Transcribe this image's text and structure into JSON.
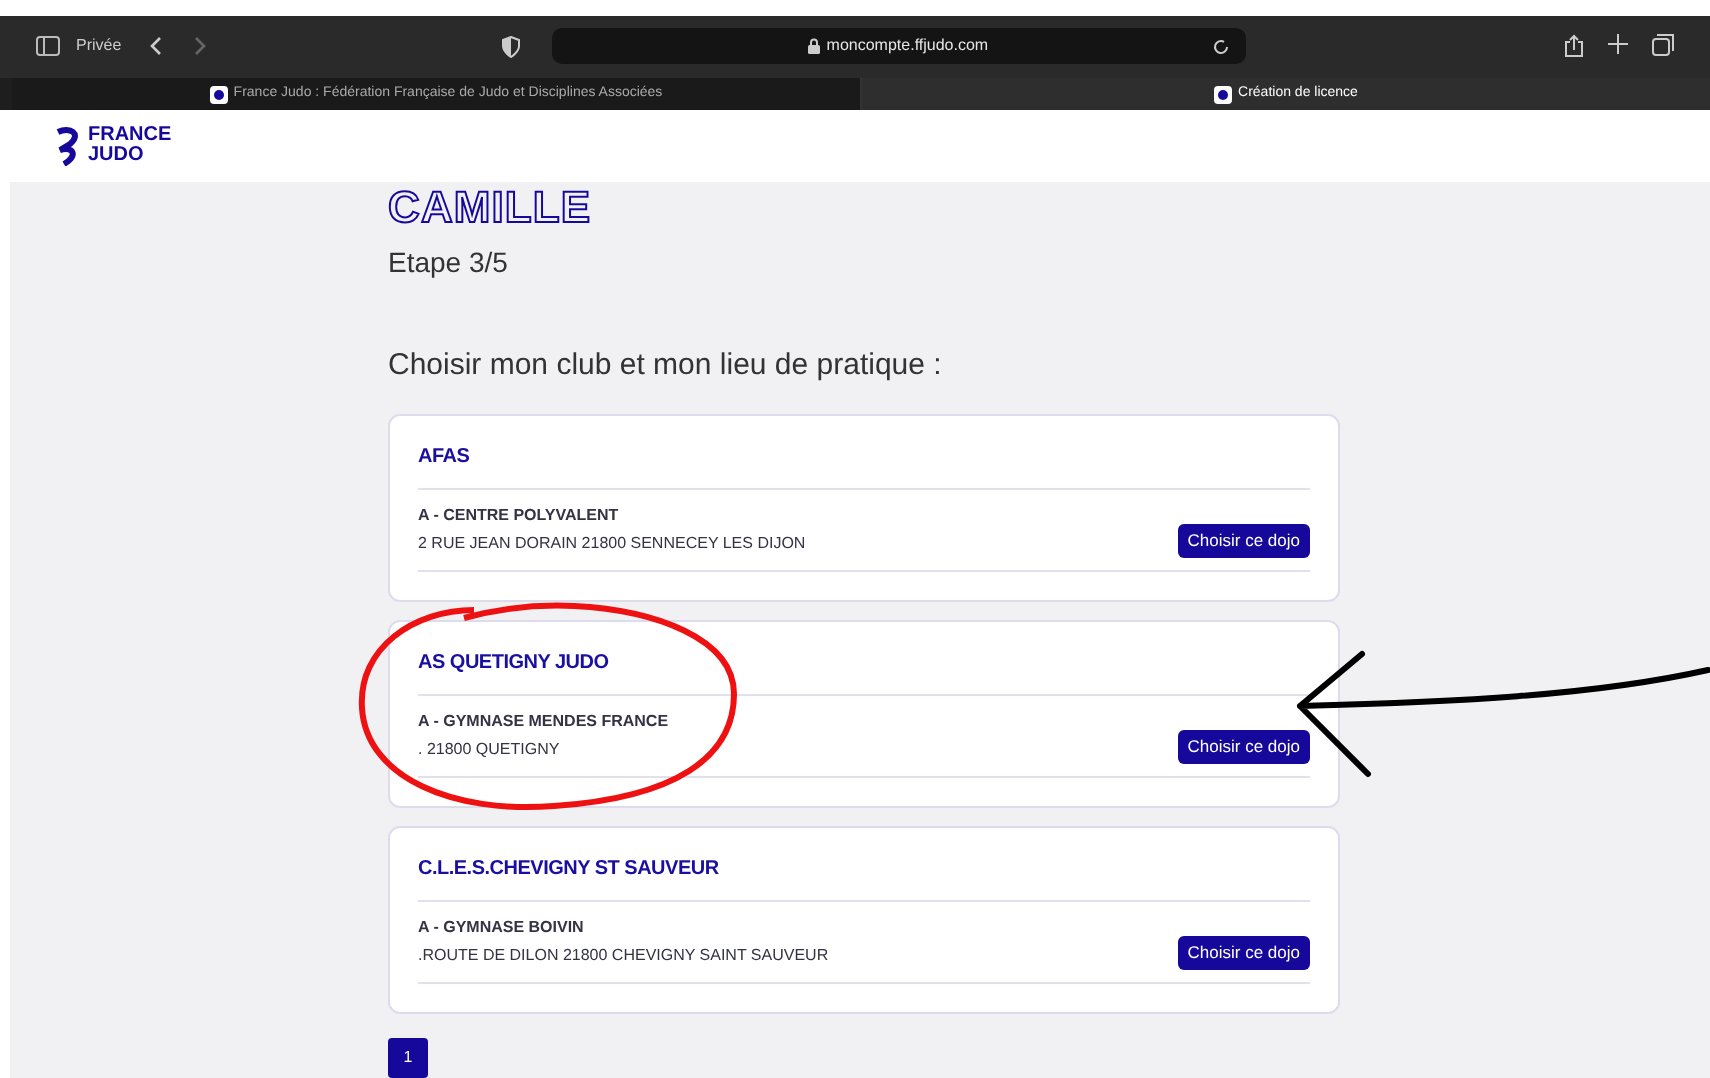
{
  "browser": {
    "private_label": "Privée",
    "url": "moncompte.ffjudo.com",
    "tabs": [
      {
        "title": "France Judo : Fédération Française de Judo et Disciplines Associées",
        "selected": false
      },
      {
        "title": "Création de licence",
        "selected": true
      }
    ]
  },
  "header": {
    "logo_line_1": "FRANCE",
    "logo_line_2": "JUDO"
  },
  "page": {
    "name": "CAMILLE",
    "step": "Etape 3/5",
    "heading": "Choisir mon club et mon lieu de pratique :",
    "clubs": [
      {
        "club": "AFAS",
        "place": "A - CENTRE POLYVALENT",
        "address": "2 RUE JEAN DORAIN 21800 SENNECEY LES DIJON",
        "button": "Choisir ce dojo",
        "circled": false,
        "arrow": false
      },
      {
        "club": "AS QUETIGNY JUDO",
        "place": "A - GYMNASE MENDES FRANCE",
        "address": ". 21800 QUETIGNY",
        "button": "Choisir ce dojo",
        "circled": true,
        "arrow": true
      },
      {
        "club": "C.L.E.S.CHEVIGNY ST SAUVEUR",
        "place": "A - GYMNASE BOIVIN",
        "address": ".ROUTE DE DILON 21800 CHEVIGNY SAINT SAUVEUR",
        "button": "Choisir ce dojo",
        "circled": false,
        "arrow": false
      }
    ],
    "pages": [
      {
        "label": "1",
        "selected": true
      }
    ]
  }
}
